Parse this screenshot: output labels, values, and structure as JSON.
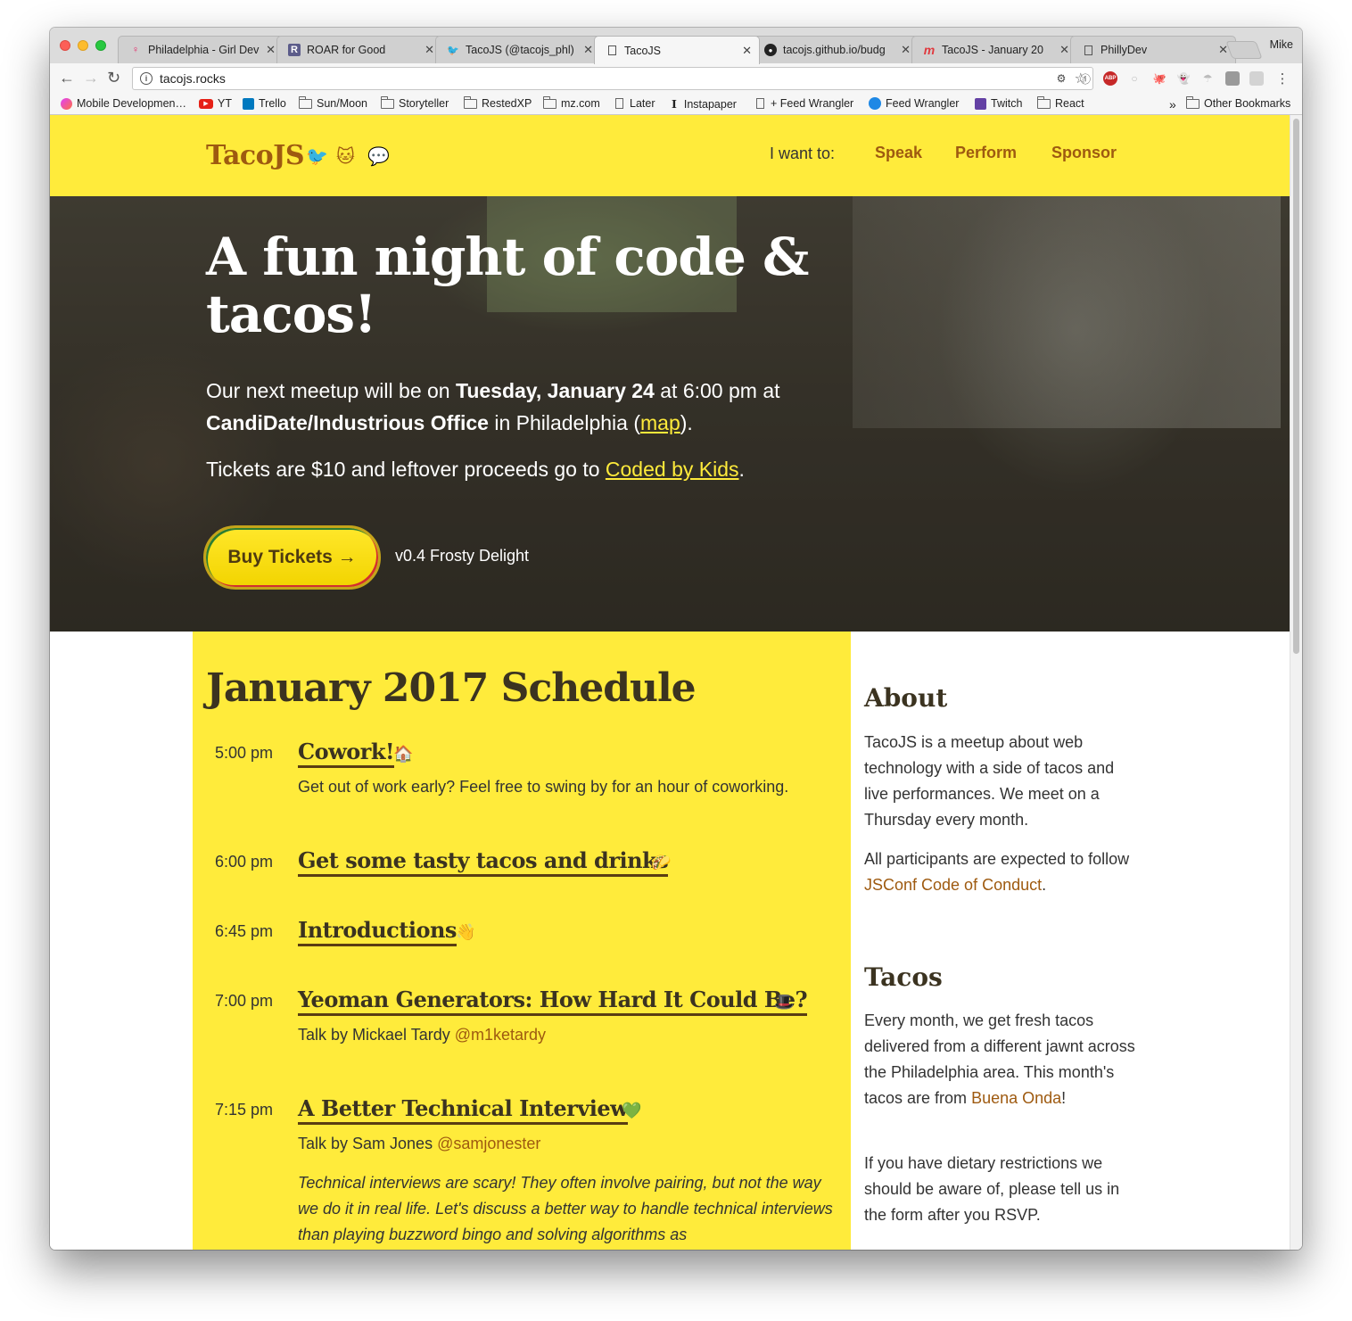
{
  "browser": {
    "tabs": [
      {
        "title": "Philadelphia - Girl Dev",
        "icon": "girl-dev-icon",
        "active": false
      },
      {
        "title": "ROAR for Good",
        "icon": "roar-icon",
        "active": false
      },
      {
        "title": "TacoJS (@tacojs_phl)",
        "icon": "twitter-icon",
        "active": false
      },
      {
        "title": "TacoJS",
        "icon": "page-icon",
        "active": true
      },
      {
        "title": "tacojs.github.io/budg",
        "icon": "github-icon",
        "active": false
      },
      {
        "title": "TacoJS - January 20",
        "icon": "meetup-icon",
        "active": false
      },
      {
        "title": "PhillyDev",
        "icon": "page-icon",
        "active": false
      }
    ],
    "profile": "Mike",
    "url": "tacojs.rocks",
    "bookmarks": [
      {
        "label": "Mobile Developmen…",
        "icon": "mobile"
      },
      {
        "label": "YT",
        "icon": "yt"
      },
      {
        "label": "Trello",
        "icon": "trello"
      },
      {
        "label": "Sun/Moon",
        "icon": "folder"
      },
      {
        "label": "Storyteller",
        "icon": "folder"
      },
      {
        "label": "RestedXP",
        "icon": "folder"
      },
      {
        "label": "mz.com",
        "icon": "folder"
      },
      {
        "label": "Later",
        "icon": "page"
      },
      {
        "label": "Instapaper",
        "icon": "instapaper"
      },
      {
        "label": "+ Feed Wrangler",
        "icon": "page"
      },
      {
        "label": "Feed Wrangler",
        "icon": "fw"
      },
      {
        "label": "Twitch",
        "icon": "twitch"
      },
      {
        "label": "React",
        "icon": "folder"
      }
    ],
    "other_bookmarks": "Other Bookmarks",
    "overflow": "»"
  },
  "site": {
    "logo": "TacoJS",
    "nav_prompt": "I want to:",
    "nav": [
      "Speak",
      "Perform",
      "Sponsor"
    ],
    "colors": {
      "yellow": "#ffeb3b",
      "brown": "#9e5a10",
      "dark": "#3b3320"
    }
  },
  "hero": {
    "headline": "A fun night of code & tacos!",
    "meetup_prefix": "Our next meetup will be on",
    "meetup_date": "Tuesday, January 24",
    "meetup_time": "at 6:00 pm at",
    "venue": "CandiDate/Industrious Office",
    "venue_suffix": "in Philadelphia (",
    "map_link": "map",
    "venue_end": ").",
    "tickets_prefix": "Tickets are $10 and leftover proceeds go to",
    "charity_link": "Coded by Kids",
    "tickets_end": ".",
    "buy_label": "Buy Tickets →",
    "version": "v0.4 Frosty Delight"
  },
  "schedule": {
    "title": "January 2017 Schedule",
    "items": [
      {
        "time": "5:00 pm",
        "title": "Cowork!",
        "emoji": "🏠",
        "desc": "Get out of work early? Feel free to swing by for an hour of coworking."
      },
      {
        "time": "6:00 pm",
        "title": "Get some tasty tacos and drinks",
        "emoji": "🌮"
      },
      {
        "time": "6:45 pm",
        "title": "Introductions",
        "emoji": "👋"
      },
      {
        "time": "7:00 pm",
        "title": "Yeoman Generators: How Hard It Could Be?",
        "emoji": "🎩",
        "speaker_prefix": "Talk by Mickael Tardy",
        "handle": "@m1ketardy"
      },
      {
        "time": "7:15 pm",
        "title": "A Better Technical Interview",
        "emoji": "💚",
        "speaker_prefix": "Talk by Sam Jones",
        "handle": "@samjonester",
        "abstract": "Technical interviews are scary! They often involve pairing, but not the way we do it in real life. Let's discuss a better way to handle technical interviews than playing buzzword bingo and solving algorithms as"
      }
    ]
  },
  "sidebar": {
    "about_title": "About",
    "about_text": "TacoJS is a meetup about web technology with a side of tacos and live performances. We meet on a Thursday every month.",
    "conduct_prefix": "All participants are expected to follow",
    "conduct_link": "JSConf Code of Conduct",
    "conduct_end": ".",
    "tacos_title": "Tacos",
    "tacos_text": "Every month, we get fresh tacos delivered from a different jawnt across the Philadelphia area. This month's tacos are from",
    "tacos_link": "Buena Onda",
    "tacos_end": "!",
    "dietary_text": "If you have dietary restrictions we should be aware of, please tell us in the form after you RSVP."
  }
}
